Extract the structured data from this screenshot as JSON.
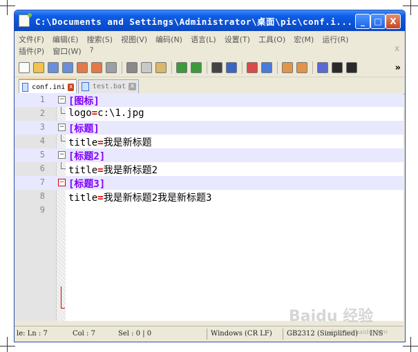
{
  "window": {
    "title": "C:\\Documents and Settings\\Administrator\\桌面\\pic\\conf.i...",
    "controls": {
      "minimize": "_",
      "maximize": "□",
      "close": "X"
    }
  },
  "menu": {
    "row1": [
      "文件(F)",
      "编辑(E)",
      "搜索(S)",
      "视图(V)",
      "编码(N)",
      "语言(L)",
      "设置(T)",
      "工具(O)",
      "宏(M)",
      "运行(R)"
    ],
    "row2": [
      "插件(P)",
      "窗口(W)",
      "?"
    ],
    "close_mark": "X"
  },
  "toolbar": {
    "icons": [
      "new-file-icon",
      "open-file-icon",
      "save-icon",
      "save-all-icon",
      "close-icon",
      "close-all-icon",
      "print-icon",
      "cut-icon",
      "copy-icon",
      "paste-icon",
      "undo-icon",
      "redo-icon",
      "find-icon",
      "replace-icon",
      "zoom-in-icon",
      "zoom-out-icon",
      "sync-vertical-icon",
      "sync-horizontal-icon",
      "word-wrap-icon",
      "show-all-chars-icon",
      "indent-guide-icon"
    ],
    "overflow": "»"
  },
  "tabs": [
    {
      "label": "conf.ini",
      "active": true
    },
    {
      "label": "test.bat",
      "active": false
    }
  ],
  "editor": {
    "lines": [
      {
        "n": "1",
        "type": "section",
        "text": "[图标]",
        "fold": "⊟"
      },
      {
        "n": "2",
        "type": "kv",
        "key": "logo",
        "eq": "=",
        "value": "c:\\1.jpg"
      },
      {
        "n": "3",
        "type": "section",
        "text": "[标题]",
        "fold": "⊟"
      },
      {
        "n": "4",
        "type": "kv",
        "key": "title",
        "eq": "=",
        "value": "我是新标题"
      },
      {
        "n": "5",
        "type": "section",
        "text": "[标题2]",
        "fold": "⊟"
      },
      {
        "n": "6",
        "type": "kv",
        "key": "title",
        "eq": "=",
        "value": "我是新标题2"
      },
      {
        "n": "7",
        "type": "section",
        "text": "[标题3]",
        "fold": "⊟"
      },
      {
        "n": "8",
        "type": "kv",
        "key": "title",
        "eq": "=",
        "value": "我是新标题2我是新标题3"
      },
      {
        "n": "9",
        "type": "empty"
      }
    ]
  },
  "status": {
    "len": "le: Ln : 7",
    "col": "Col : 7",
    "sel": "Sel : 0 | 0",
    "eol": "Windows (CR LF)",
    "encoding": "GB2312 (Simplified)",
    "mode": "INS"
  },
  "watermark": {
    "main": "Baidu 经验",
    "sub": "jingyan.baidu.com"
  }
}
